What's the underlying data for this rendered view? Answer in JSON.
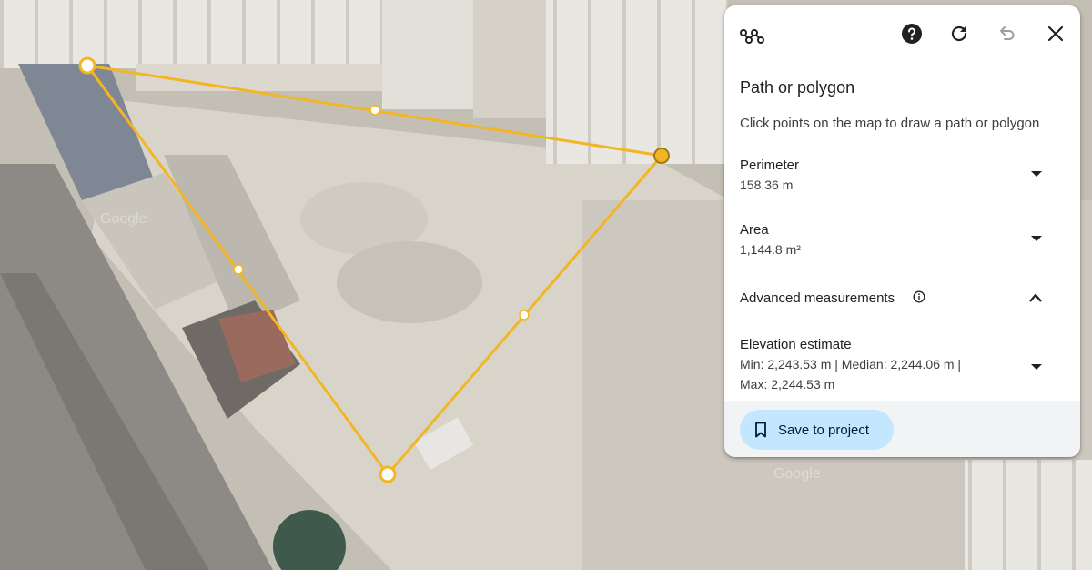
{
  "map": {
    "watermarks": [
      "Google",
      "Google"
    ]
  },
  "panel": {
    "tool_icon": "path-measure-icon",
    "title": "Path or polygon",
    "subtitle": "Click points on the map to draw a path or polygon",
    "perimeter": {
      "label": "Perimeter",
      "value": "158.36 m"
    },
    "area": {
      "label": "Area",
      "value": "1,144.8 m²"
    },
    "advanced": {
      "label": "Advanced measurements"
    },
    "elevation": {
      "label": "Elevation estimate",
      "line1": "Min: 2,243.53 m | Median: 2,244.06 m |",
      "line2": "Max: 2,244.53 m"
    },
    "save_label": "Save to project"
  },
  "colors": {
    "polygon_stroke": "#f2b624",
    "save_button_bg": "#c2e7ff",
    "panel_bg": "#ffffff"
  }
}
